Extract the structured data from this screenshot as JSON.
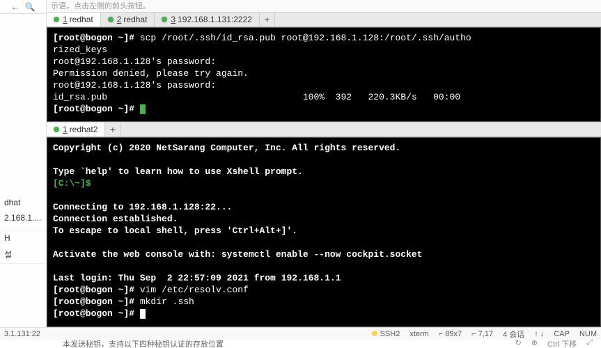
{
  "hint_text": "示语，点击左侧的前头按钮。",
  "sidebar": {
    "items": [
      "dhat",
      "2.168.1...."
    ],
    "section_h": "H",
    "section_item": "설"
  },
  "tabs_top": [
    {
      "num": "1",
      "label": "redhat",
      "active": true
    },
    {
      "num": "2",
      "label": "redhat",
      "active": false
    },
    {
      "num": "3",
      "label": "192.168.1.131:2222",
      "active": false
    }
  ],
  "terminal1": {
    "line1_prompt": "[root@bogon ~]#",
    "line1_cmd": " scp /root/.ssh/id_rsa.pub root@192.168.1.128:/root/.ssh/autho",
    "line2": "rized_keys",
    "line3": "root@192.168.1.128's password:",
    "line4": "Permission denied, please try again.",
    "line5": "root@192.168.1.128's password:",
    "line6": "id_rsa.pub                                    100%  392   220.3KB/s   00:00",
    "line7_prompt": "[root@bogon ~]# "
  },
  "tabs_bottom": [
    {
      "num": "1",
      "label": "redhat2",
      "active": true
    }
  ],
  "terminal2": {
    "line1": "Copyright (c) 2020 NetSarang Computer, Inc. All rights reserved.",
    "line3": "Type `help' to learn how to use Xshell prompt.",
    "line4": "[C:\\~]$",
    "line6": "Connecting to 192.168.1.128:22...",
    "line7": "Connection established.",
    "line8": "To escape to local shell, press 'Ctrl+Alt+]'.",
    "line10": "Activate the web console with: systemctl enable --now cockpit.socket",
    "line12": "Last login: Thu Sep  2 22:57:09 2021 from 192.168.1.1",
    "line13_prompt": "[root@bogon ~]#",
    "line13_cmd": " vim /etc/resolv.conf",
    "line14_prompt": "[root@bogon ~]#",
    "line14_cmd": " mkdir .ssh",
    "line15_prompt": "[root@bogon ~]# "
  },
  "statusbar": {
    "left": "3.1.131:22",
    "ssh": "SSH2",
    "xterm": "xterm",
    "size": "⌐ 89x7",
    "pos": "⌐ 7,17",
    "session": "4 会话",
    "arrows": "↑ ↓",
    "cap": "CAP",
    "num": "NUM"
  },
  "bottomrow": {
    "text": "本发送秘钥，支持以下四种秘钥认证的存放位置",
    "icons": [
      "↻",
      "⊕",
      "Ctrl 下移",
      "⤢"
    ]
  },
  "add_label": "+"
}
